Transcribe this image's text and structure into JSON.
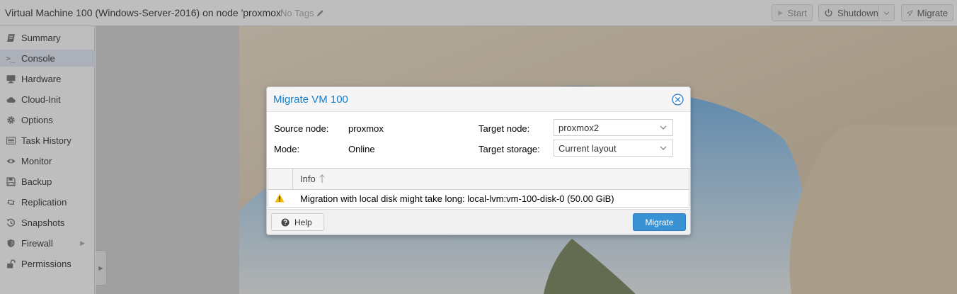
{
  "header": {
    "title": "Virtual Machine 100 (Windows-Server-2016) on node 'proxmox'",
    "tags": "No Tags",
    "start_label": "Start",
    "shutdown_label": "Shutdown",
    "migrate_label": "Migrate"
  },
  "sidebar": {
    "items": [
      {
        "label": "Summary",
        "icon": "summary-icon"
      },
      {
        "label": "Console",
        "icon": "console-icon",
        "active": true
      },
      {
        "label": "Hardware",
        "icon": "monitor-icon"
      },
      {
        "label": "Cloud-Init",
        "icon": "cloud-icon"
      },
      {
        "label": "Options",
        "icon": "gear-icon"
      },
      {
        "label": "Task History",
        "icon": "list-icon"
      },
      {
        "label": "Monitor",
        "icon": "eye-icon"
      },
      {
        "label": "Backup",
        "icon": "floppy-icon"
      },
      {
        "label": "Replication",
        "icon": "retweet-icon"
      },
      {
        "label": "Snapshots",
        "icon": "history-icon"
      },
      {
        "label": "Firewall",
        "icon": "shield-icon"
      },
      {
        "label": "Permissions",
        "icon": "unlock-icon"
      }
    ]
  },
  "dialog": {
    "title": "Migrate VM 100",
    "source_node_label": "Source node:",
    "source_node_value": "proxmox",
    "mode_label": "Mode:",
    "mode_value": "Online",
    "target_node_label": "Target node:",
    "target_node_value": "proxmox2",
    "target_storage_label": "Target storage:",
    "target_storage_value": "Current layout",
    "grid": {
      "column": "Info",
      "rows": [
        {
          "icon": "warning-icon",
          "message": "Migration with local disk might take long: local-lvm:vm-100-disk-0 (50.00 GiB)"
        }
      ]
    },
    "help_label": "Help",
    "migrate_label": "Migrate"
  },
  "colors": {
    "accent": "#157fcc",
    "primary_button": "#3892d4",
    "warning": "#f5b800",
    "active_nav": "#dfe8f6"
  }
}
